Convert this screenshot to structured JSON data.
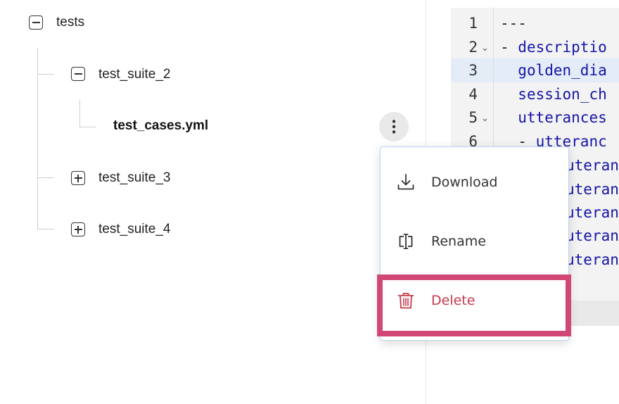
{
  "file_tree": {
    "root": {
      "label": "tests",
      "expanded": true
    },
    "children": [
      {
        "label": "test_suite_2",
        "expanded": true,
        "children": [
          {
            "label": "test_cases.yml",
            "selected": true
          }
        ]
      },
      {
        "label": "test_suite_3",
        "expanded": false
      },
      {
        "label": "test_suite_4",
        "expanded": false
      }
    ],
    "more_actions_icon": "vertical-ellipsis-icon"
  },
  "editor": {
    "active_line": 3,
    "lines": [
      {
        "number": "1",
        "text": "---",
        "fold": ""
      },
      {
        "number": "2",
        "dash": "- ",
        "text": "descriptio",
        "fold": "⌄"
      },
      {
        "number": "3",
        "indent": "  ",
        "text": "golden_dia",
        "fold": ""
      },
      {
        "number": "4",
        "indent": "  ",
        "text": "session_ch",
        "fold": ""
      },
      {
        "number": "5",
        "indent": "  ",
        "text": "utterances",
        "fold": "⌄"
      },
      {
        "number": "6",
        "indent": "  ",
        "dash": "- ",
        "text": "utteranc",
        "fold": ""
      },
      {
        "number": "",
        "text": "uteranc"
      },
      {
        "number": "",
        "text": "uteranc"
      },
      {
        "number": "",
        "text": "uteranc"
      },
      {
        "number": "",
        "text": "uteranc"
      },
      {
        "number": "",
        "text": "uteranc"
      }
    ]
  },
  "context_menu": {
    "items": [
      {
        "label": "Download",
        "icon": "download-icon"
      },
      {
        "label": "Rename",
        "icon": "rename-icon"
      },
      {
        "label": "Delete",
        "icon": "trash-icon",
        "danger": true,
        "highlighted": true
      }
    ]
  },
  "colors": {
    "danger": "#c63a4a",
    "highlight_border": "#d14877",
    "code_key": "#1515a8",
    "active_line_bg": "#e3ecf7",
    "menu_border": "#bcd4f0"
  }
}
